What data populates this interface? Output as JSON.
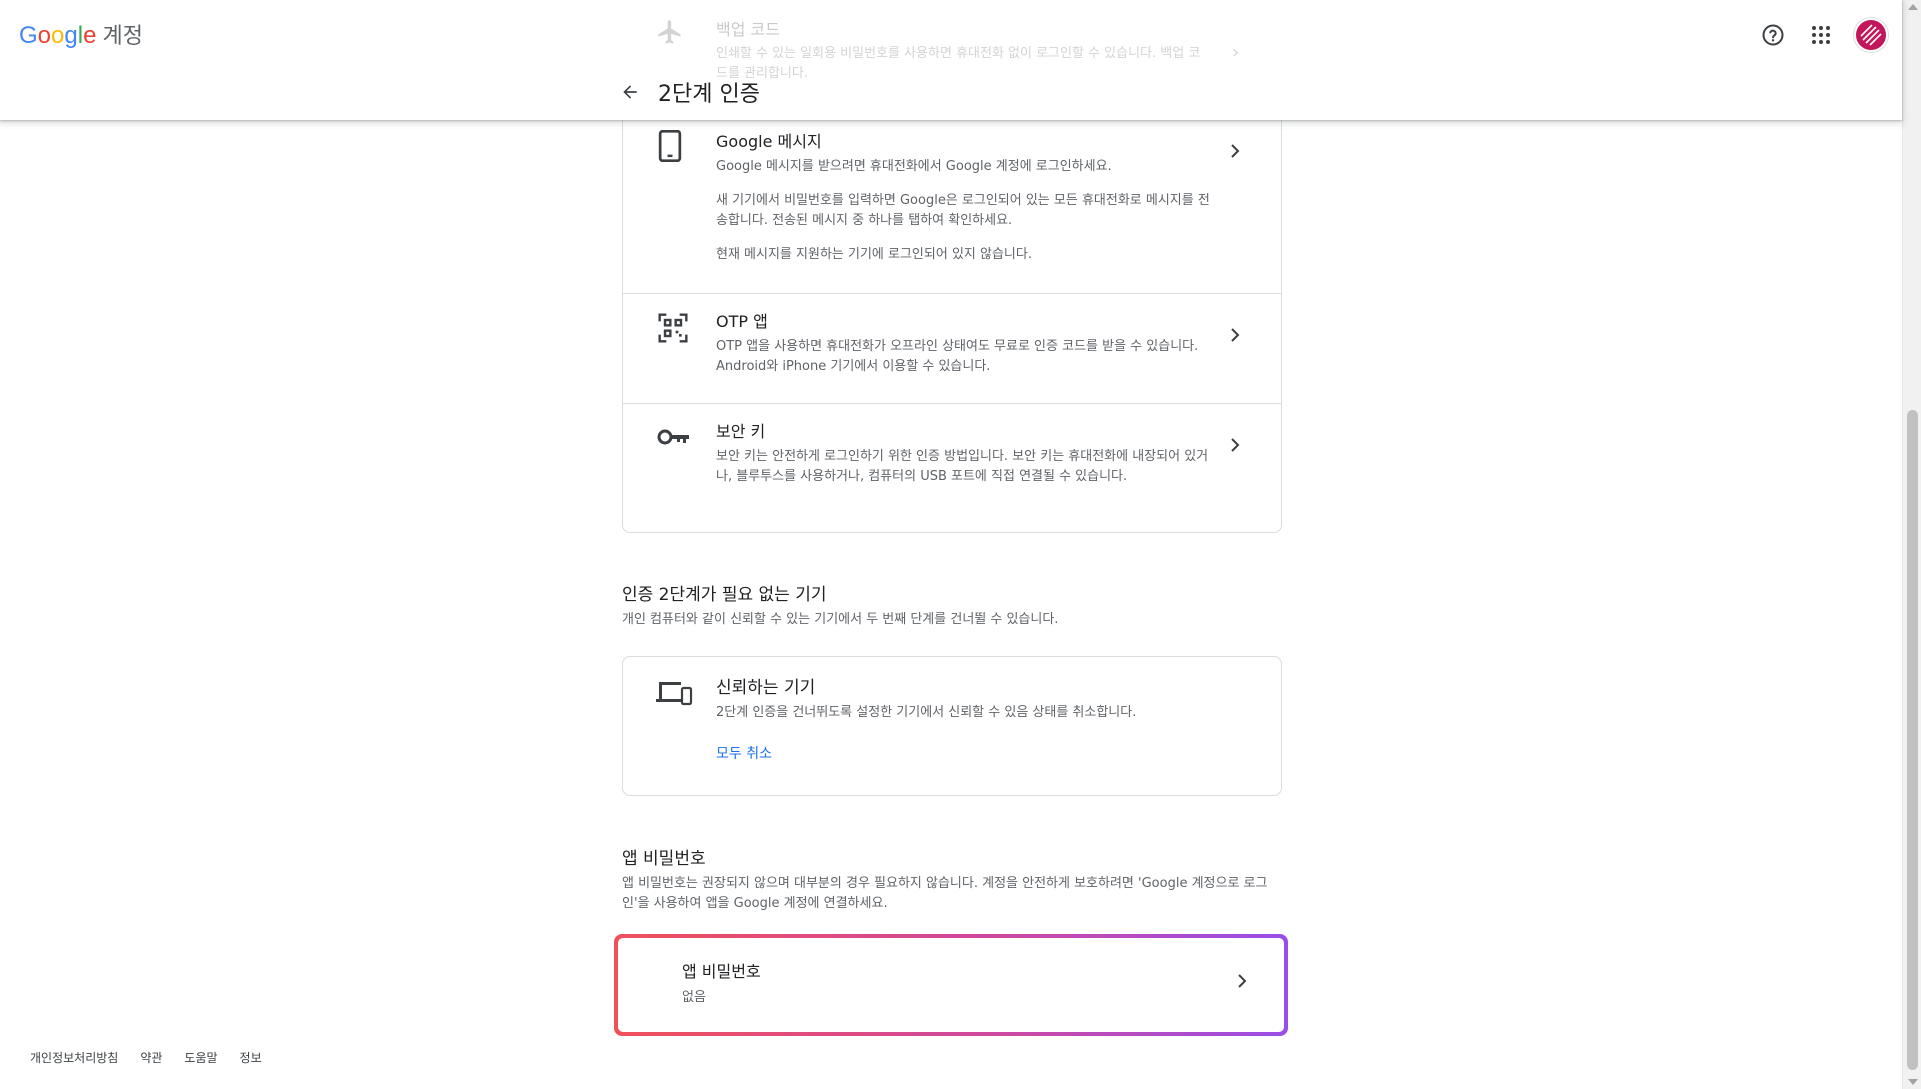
{
  "header": {
    "logo_letters": [
      "G",
      "o",
      "o",
      "g",
      "l",
      "e"
    ],
    "product": "계정",
    "page_title": "2단계 인증"
  },
  "ghost_item": {
    "title": "백업 코드",
    "description": "인쇄할 수 있는 일회용 비밀번호를 사용하면 휴대전화 없이 로그인할 수 있습니다. 백업 코드를 관리합니다."
  },
  "options": [
    {
      "title": "Google 메시지",
      "descriptions": [
        "Google 메시지를 받으려면 휴대전화에서 Google 계정에 로그인하세요.",
        "새 기기에서 비밀번호를 입력하면 Google은 로그인되어 있는 모든 휴대전화로 메시지를 전송합니다. 전송된 메시지 중 하나를 탭하여 확인하세요.",
        "현재 메시지를 지원하는 기기에 로그인되어 있지 않습니다."
      ]
    },
    {
      "title": "OTP 앱",
      "descriptions": [
        "OTP 앱을 사용하면 휴대전화가 오프라인 상태여도 무료로 인증 코드를 받을 수 있습니다. Android와 iPhone 기기에서 이용할 수 있습니다."
      ]
    },
    {
      "title": "보안 키",
      "descriptions": [
        "보안 키는 안전하게 로그인하기 위한 인증 방법입니다. 보안 키는 휴대전화에 내장되어 있거나, 블루투스를 사용하거나, 컴퓨터의 USB 포트에 직접 연결될 수 있습니다."
      ]
    }
  ],
  "trusted_section": {
    "heading": "인증 2단계가 필요 없는 기기",
    "description": "개인 컴퓨터와 같이 신뢰할 수 있는 기기에서 두 번째 단계를 건너뛸 수 있습니다.",
    "card_title": "신뢰하는 기기",
    "card_description": "2단계 인증을 건너뛰도록 설정한 기기에서 신뢰할 수 있음 상태를 취소합니다.",
    "revoke_all": "모두 취소"
  },
  "app_password_section": {
    "heading": "앱 비밀번호",
    "description": "앱 비밀번호는 권장되지 않으며 대부분의 경우 필요하지 않습니다. 계정을 안전하게 보호하려면 'Google 계정으로 로그인'을 사용하여 앱을 Google 계정에 연결하세요.",
    "card_title": "앱 비밀번호",
    "card_value": "없음"
  },
  "footer": [
    "개인정보처리방침",
    "약관",
    "도움말",
    "정보"
  ],
  "colors": {
    "accent_blue": "#1a73e8",
    "highlight_gradient_start": "#f0505a",
    "highlight_gradient_end": "#9a4ee8",
    "avatar": "#c2185b"
  },
  "icons": {
    "back": "arrow-left-icon",
    "help": "help-circle-icon",
    "apps": "apps-grid-icon",
    "google_message": "smartphone-icon",
    "otp": "qr-code-icon",
    "security_key": "key-icon",
    "trusted_devices": "devices-icon",
    "chevron": "chevron-right-icon"
  }
}
